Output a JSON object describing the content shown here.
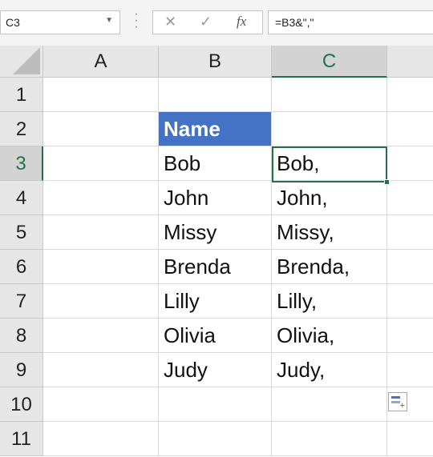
{
  "name_box": {
    "value": "C3"
  },
  "formula_bar": {
    "cancel_glyph": "✕",
    "enter_glyph": "✓",
    "fx_glyph": "fx",
    "formula": "=B3&\",\""
  },
  "columns": [
    "A",
    "B",
    "C"
  ],
  "selected_column": "C",
  "rows": [
    "1",
    "2",
    "3",
    "4",
    "5",
    "6",
    "7",
    "8",
    "9",
    "10",
    "11"
  ],
  "selected_row": "3",
  "cells": {
    "B2": "Name",
    "B3": "Bob",
    "C3": "Bob,",
    "B4": "John",
    "C4": "John,",
    "B5": "Missy",
    "C5": "Missy,",
    "B6": "Brenda",
    "C6": "Brenda,",
    "B7": "Lilly",
    "C7": "Lilly,",
    "B8": "Olivia",
    "C8": "Olivia,",
    "B9": "Judy",
    "C9": "Judy,"
  },
  "header_cell_color": "#4472c4",
  "selection_color": "#217346",
  "quick_analysis_icon": "quick-analysis-icon"
}
